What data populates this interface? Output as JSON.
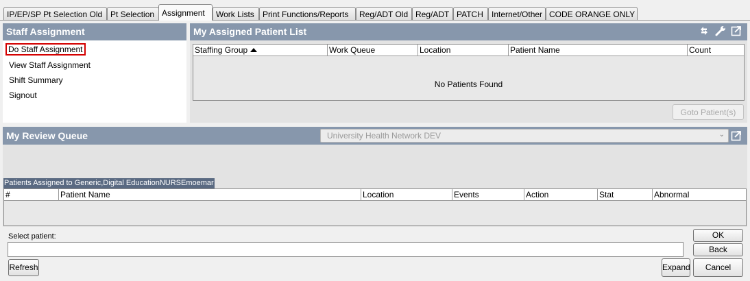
{
  "tabs": [
    {
      "label": "IP/EP/SP Pt Selection Old",
      "active": false
    },
    {
      "label": "Pt Selection",
      "active": false
    },
    {
      "label": "Assignment",
      "active": true
    },
    {
      "label": "Work Lists",
      "active": false
    },
    {
      "label": "Print Functions/Reports",
      "active": false
    },
    {
      "label": "Reg/ADT Old",
      "active": false
    },
    {
      "label": "Reg/ADT",
      "active": false
    },
    {
      "label": "PATCH",
      "active": false
    },
    {
      "label": "Internet/Other",
      "active": false
    },
    {
      "label": "CODE ORANGE ONLY",
      "active": false
    }
  ],
  "staff_assignment": {
    "title": "Staff Assignment",
    "links": [
      "Do Staff Assignment",
      "View Staff Assignment",
      "Shift Summary",
      "Signout"
    ]
  },
  "assigned_list": {
    "title": "My Assigned Patient List",
    "columns": [
      "Staffing Group",
      "Work Queue",
      "Location",
      "Patient Name",
      "Count"
    ],
    "empty_message": "No Patients Found",
    "goto_button": "Goto Patient(s)"
  },
  "review_queue": {
    "title": "My Review Queue",
    "dropdown_value": "University Health Network DEV",
    "assigned_caption": "Patients Assigned to Generic,Digital EducationNURSEmoemar",
    "columns": [
      "#",
      "Patient Name",
      "Location",
      "Events",
      "Action",
      "Stat",
      "Abnormal"
    ]
  },
  "bottom": {
    "select_label": "Select patient:",
    "select_value": "",
    "ok": "OK",
    "back": "Back",
    "refresh": "Refresh",
    "expand": "Expand",
    "cancel": "Cancel"
  },
  "colors": {
    "header_bg": "#8797ac",
    "selected_outline": "#d40000",
    "caption_bg": "#5a6a82"
  }
}
